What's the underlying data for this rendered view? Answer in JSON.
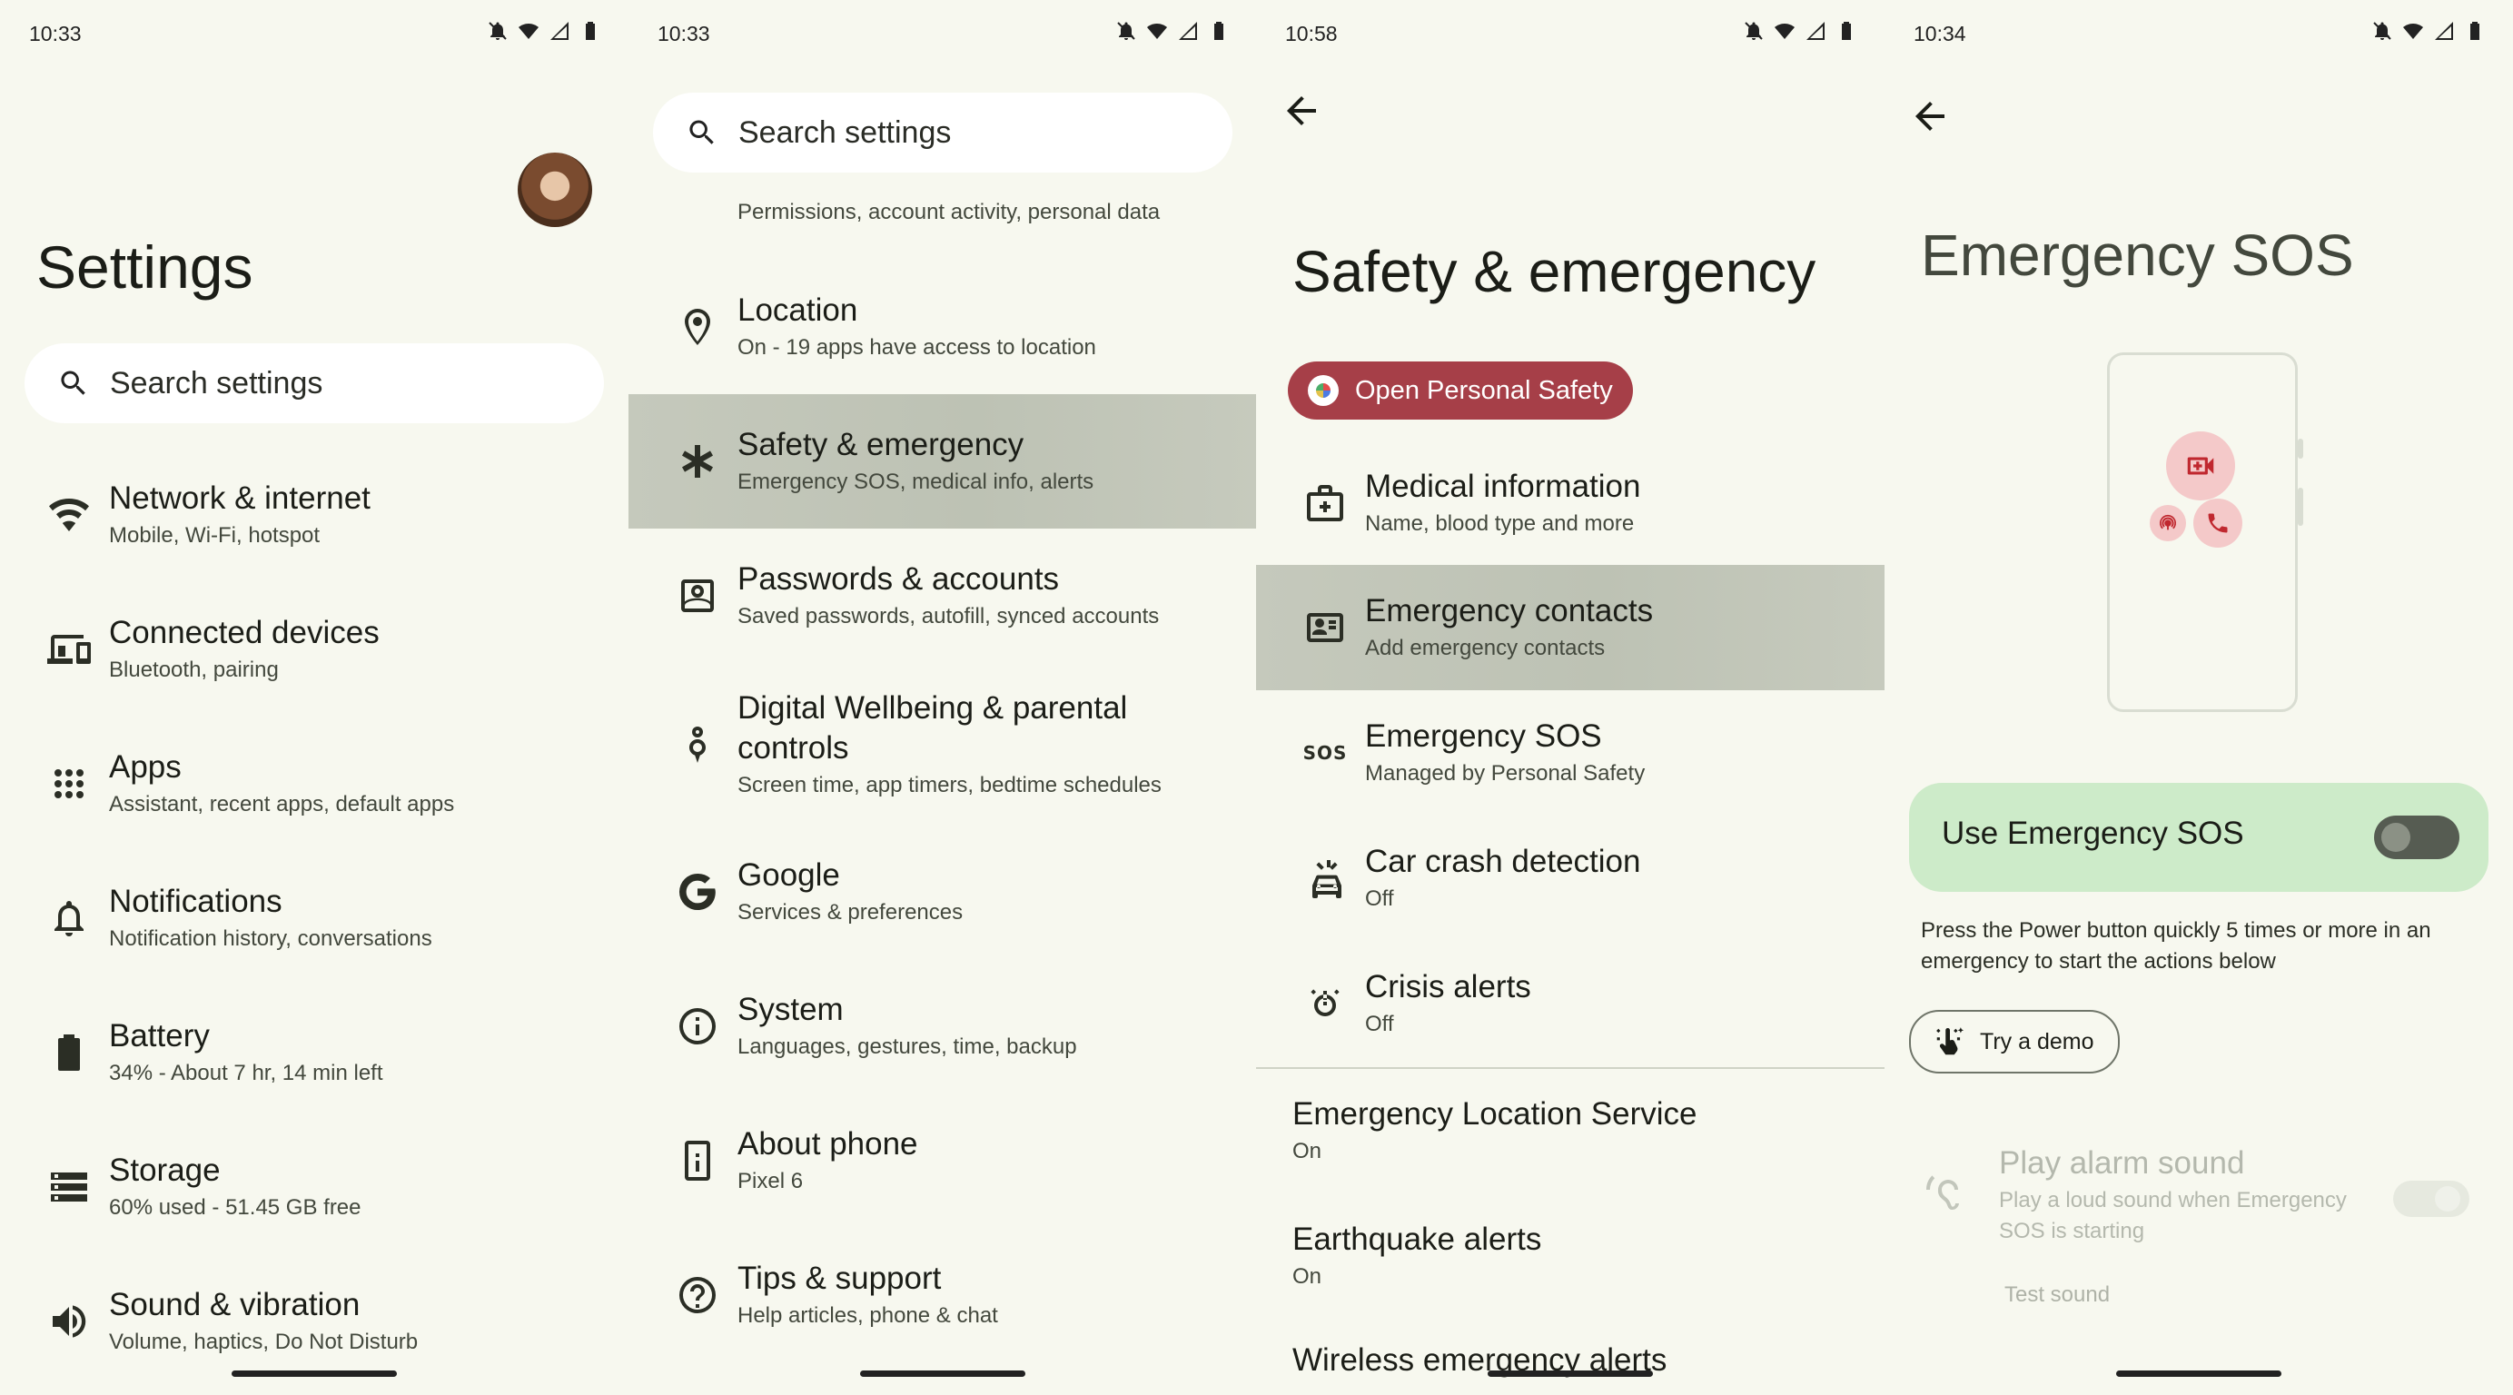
{
  "panel1": {
    "time": "10:33",
    "title": "Settings",
    "search_placeholder": "Search settings",
    "items": [
      {
        "title": "Network & internet",
        "subtitle": "Mobile, Wi-Fi, hotspot",
        "icon": "wifi-icon"
      },
      {
        "title": "Connected devices",
        "subtitle": "Bluetooth, pairing",
        "icon": "devices-icon"
      },
      {
        "title": "Apps",
        "subtitle": "Assistant, recent apps, default apps",
        "icon": "apps-grid-icon"
      },
      {
        "title": "Notifications",
        "subtitle": "Notification history, conversations",
        "icon": "bell-icon"
      },
      {
        "title": "Battery",
        "subtitle": "34% - About 7 hr, 14 min left",
        "icon": "battery-icon"
      },
      {
        "title": "Storage",
        "subtitle": "60% used - 51.45 GB free",
        "icon": "storage-icon"
      },
      {
        "title": "Sound & vibration",
        "subtitle": "Volume, haptics, Do Not Disturb",
        "icon": "speaker-icon"
      }
    ]
  },
  "panel2": {
    "time": "10:33",
    "search_placeholder": "Search settings",
    "partial_item_subtitle": "Permissions, account activity, personal data",
    "items": [
      {
        "title": "Location",
        "subtitle": "On - 19 apps have access to location",
        "icon": "location-pin-icon"
      },
      {
        "title": "Safety & emergency",
        "subtitle": "Emergency SOS, medical info, alerts",
        "icon": "asterisk-icon"
      },
      {
        "title": "Passwords & accounts",
        "subtitle": "Saved passwords, autofill, synced accounts",
        "icon": "account-box-icon"
      },
      {
        "title_line1": "Digital Wellbeing & parental",
        "title_line2": "controls",
        "subtitle": "Screen time, app timers, bedtime schedules",
        "icon": "wellbeing-icon"
      },
      {
        "title": "Google",
        "subtitle": "Services & preferences",
        "icon": "google-g-icon"
      },
      {
        "title": "System",
        "subtitle": "Languages, gestures, time, backup",
        "icon": "info-icon"
      },
      {
        "title": "About phone",
        "subtitle": "Pixel 6",
        "icon": "phone-icon"
      },
      {
        "title": "Tips & support",
        "subtitle": "Help articles, phone & chat",
        "icon": "help-icon"
      }
    ]
  },
  "panel3": {
    "time": "10:58",
    "title": "Safety & emergency",
    "open_button": "Open Personal Safety",
    "items": [
      {
        "title": "Medical information",
        "subtitle": "Name, blood type and more",
        "icon": "medical-kit-icon"
      },
      {
        "title": "Emergency contacts",
        "subtitle": "Add emergency contacts",
        "icon": "contact-card-icon"
      },
      {
        "title": "Emergency SOS",
        "subtitle": "Managed by Personal Safety",
        "icon": "sos-icon",
        "icon_text": "SOS"
      },
      {
        "title": "Car crash detection",
        "subtitle": "Off",
        "icon": "car-crash-icon"
      },
      {
        "title": "Crisis alerts",
        "subtitle": "Off",
        "icon": "crisis-alert-icon"
      }
    ],
    "more_items": [
      {
        "title": "Emergency Location Service",
        "subtitle": "On"
      },
      {
        "title": "Earthquake alerts",
        "subtitle": "On"
      },
      {
        "title": "Wireless emergency alerts",
        "subtitle": ""
      }
    ]
  },
  "panel4": {
    "time": "10:34",
    "title": "Emergency SOS",
    "toggle_label": "Use Emergency SOS",
    "toggle_state": "off",
    "description": "Press the Power button quickly 5 times or more in an emergency to start the actions below",
    "demo_button": "Try a demo",
    "alarm_title": "Play alarm sound",
    "alarm_subtitle": "Play a loud sound when Emergency SOS is starting",
    "test_sound": "Test sound"
  },
  "colors": {
    "background": "#f7f8ef",
    "highlight": "#c1c6b8",
    "personal_safety_button": "#a63f48",
    "toggle_card": "#cdebc9",
    "sos_red": "#c0282f"
  }
}
